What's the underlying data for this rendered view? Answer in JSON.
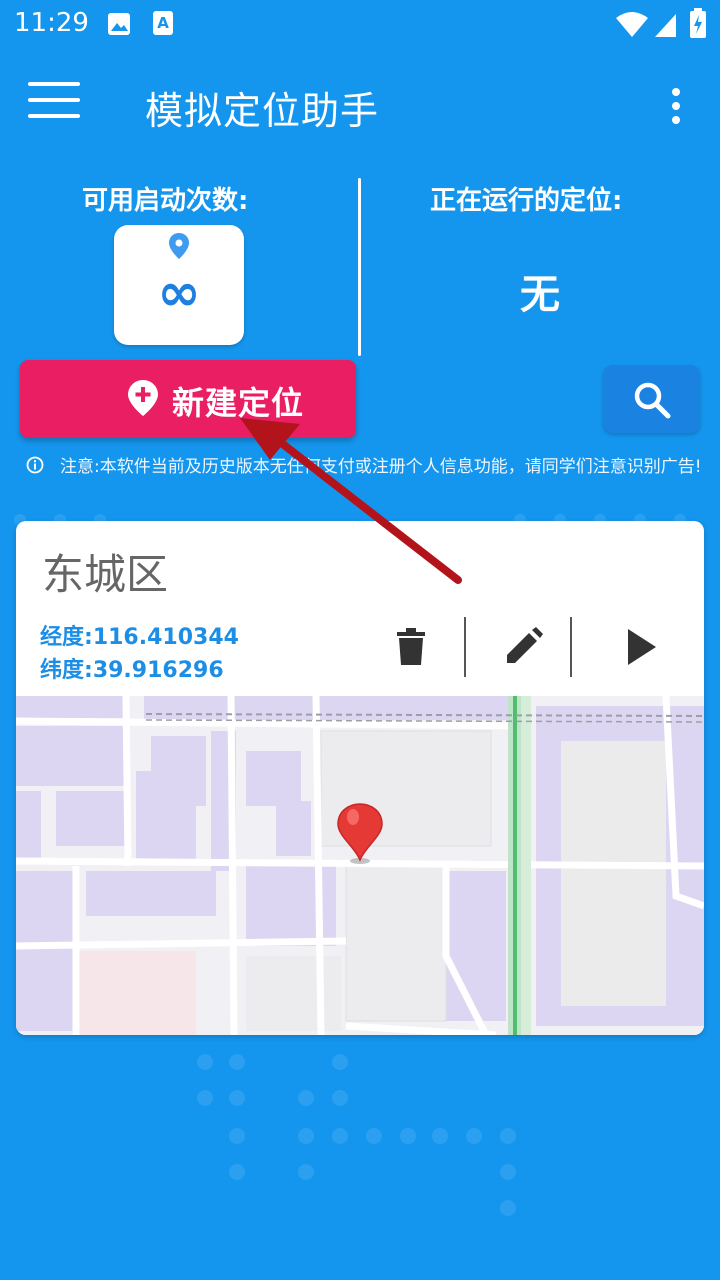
{
  "status_bar": {
    "time": "11:29",
    "icons": [
      "image-notification-icon",
      "text-notification-icon",
      "wifi-icon",
      "signal-icon",
      "battery-charging-icon"
    ]
  },
  "app_bar": {
    "title": "模拟定位助手",
    "menu_icon": "hamburger-menu-icon",
    "overflow_icon": "more-vert-icon"
  },
  "launch_count": {
    "label": "可用启动次数:",
    "value": "∞",
    "icon": "location-pin-icon"
  },
  "running": {
    "label": "正在运行的定位:",
    "value": "无"
  },
  "new_location_button": {
    "label": "新建定位",
    "icon": "add-location-icon"
  },
  "search_button": {
    "icon": "search-icon"
  },
  "notice": {
    "icon": "info-icon",
    "text": "注意:本软件当前及历史版本无任何支付或注册个人信息功能，请同学们注意识别广告!"
  },
  "location_card": {
    "name": "东城区",
    "longitude_label": "经度:",
    "longitude": "116.410344",
    "latitude_label": "纬度:",
    "latitude": "39.916296",
    "actions": [
      "delete-icon",
      "edit-icon",
      "play-icon"
    ]
  },
  "colors": {
    "background": "#1596ee",
    "accent_pink": "#e91e63",
    "coord_blue": "#1d8ee6",
    "map_pin_red": "#e53935"
  }
}
